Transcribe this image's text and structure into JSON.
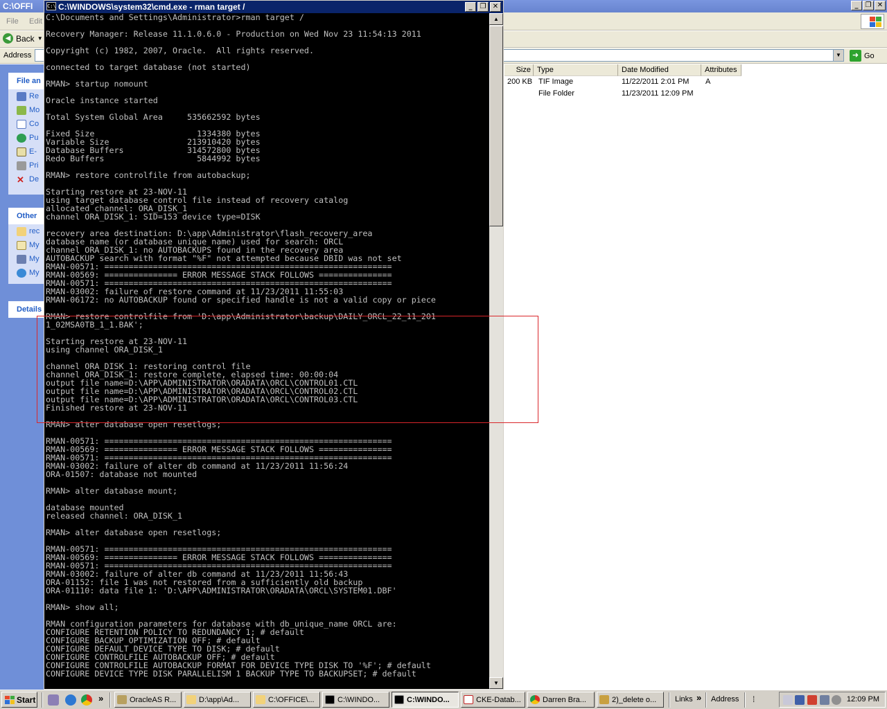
{
  "explorer": {
    "title": "C:\\OFFI",
    "menu": [
      "File",
      "Edit"
    ],
    "back_label": "Back",
    "address_label": "Address",
    "go_label": "Go",
    "tasks_file_head": "File an",
    "tasks_file_items": [
      "Re",
      "Mo",
      "Co",
      "Pu",
      "E-",
      "Pri",
      "De"
    ],
    "tasks_other_head": "Other",
    "tasks_other_items": [
      "rec",
      "My",
      "My",
      "My"
    ],
    "tasks_details_head": "Details",
    "columns": [
      "Size",
      "Type",
      "Date Modified",
      "Attributes"
    ],
    "rows": [
      {
        "size": "200 KB",
        "type": "TIF Image",
        "date": "11/22/2011 2:01 PM",
        "attr": "A"
      },
      {
        "size": "",
        "type": "File Folder",
        "date": "11/23/2011 12:09 PM",
        "attr": ""
      }
    ]
  },
  "cmd": {
    "title": "C:\\WINDOWS\\system32\\cmd.exe - rman target /",
    "icon_text": "C:\\",
    "console_text": "C:\\Documents and Settings\\Administrator>rman target /\n\nRecovery Manager: Release 11.1.0.6.0 - Production on Wed Nov 23 11:54:13 2011\n\nCopyright (c) 1982, 2007, Oracle.  All rights reserved.\n\nconnected to target database (not started)\n\nRMAN> startup nomount\n\nOracle instance started\n\nTotal System Global Area     535662592 bytes\n\nFixed Size                     1334380 bytes\nVariable Size                213910420 bytes\nDatabase Buffers             314572800 bytes\nRedo Buffers                   5844992 bytes\n\nRMAN> restore controlfile from autobackup;\n\nStarting restore at 23-NOV-11\nusing target database control file instead of recovery catalog\nallocated channel: ORA_DISK_1\nchannel ORA_DISK_1: SID=153 device type=DISK\n\nrecovery area destination: D:\\app\\Administrator\\flash_recovery_area\ndatabase name (or database unique name) used for search: ORCL\nchannel ORA_DISK_1: no AUTOBACKUPS found in the recovery area\nAUTOBACKUP search with format \"%F\" not attempted because DBID was not set\nRMAN-00571: ===========================================================\nRMAN-00569: =============== ERROR MESSAGE STACK FOLLOWS ===============\nRMAN-00571: ===========================================================\nRMAN-03002: failure of restore command at 11/23/2011 11:55:03\nRMAN-06172: no AUTOBACKUP found or specified handle is not a valid copy or piece\n\nRMAN> restore controlfile from 'D:\\app\\Administrator\\backup\\DAILY_ORCL_22_11_201\n1_02MSA0TB_1_1.BAK';\n\nStarting restore at 23-NOV-11\nusing channel ORA_DISK_1\n\nchannel ORA_DISK_1: restoring control file\nchannel ORA_DISK_1: restore complete, elapsed time: 00:00:04\noutput file name=D:\\APP\\ADMINISTRATOR\\ORADATA\\ORCL\\CONTROL01.CTL\noutput file name=D:\\APP\\ADMINISTRATOR\\ORADATA\\ORCL\\CONTROL02.CTL\noutput file name=D:\\APP\\ADMINISTRATOR\\ORADATA\\ORCL\\CONTROL03.CTL\nFinished restore at 23-NOV-11\n\nRMAN> alter database open resetlogs;\n\nRMAN-00571: ===========================================================\nRMAN-00569: =============== ERROR MESSAGE STACK FOLLOWS ===============\nRMAN-00571: ===========================================================\nRMAN-03002: failure of alter db command at 11/23/2011 11:56:24\nORA-01507: database not mounted\n\nRMAN> alter database mount;\n\ndatabase mounted\nreleased channel: ORA_DISK_1\n\nRMAN> alter database open resetlogs;\n\nRMAN-00571: ===========================================================\nRMAN-00569: =============== ERROR MESSAGE STACK FOLLOWS ===============\nRMAN-00571: ===========================================================\nRMAN-03002: failure of alter db command at 11/23/2011 11:56:43\nORA-01152: file 1 was not restored from a sufficiently old backup\nORA-01110: data file 1: 'D:\\APP\\ADMINISTRATOR\\ORADATA\\ORCL\\SYSTEM01.DBF'\n\nRMAN> show all;\n\nRMAN configuration parameters for database with db_unique_name ORCL are:\nCONFIGURE RETENTION POLICY TO REDUNDANCY 1; # default\nCONFIGURE BACKUP OPTIMIZATION OFF; # default\nCONFIGURE DEFAULT DEVICE TYPE TO DISK; # default\nCONFIGURE CONTROLFILE AUTOBACKUP OFF; # default\nCONFIGURE CONTROLFILE AUTOBACKUP FORMAT FOR DEVICE TYPE DISK TO '%F'; # default\nCONFIGURE DEVICE TYPE DISK PARALLELISM 1 BACKUP TYPE TO BACKUPSET; # default",
    "highlight_color": "#d9262a"
  },
  "taskbar": {
    "start_label": "Start",
    "more_glyph": "»",
    "buttons": [
      {
        "label": "OracleAS R...",
        "active": false
      },
      {
        "label": "D:\\app\\Ad...",
        "active": false
      },
      {
        "label": "C:\\OFFICE\\...",
        "active": false
      },
      {
        "label": "C:\\WINDO...",
        "active": false
      },
      {
        "label": "C:\\WINDO...",
        "active": true
      },
      {
        "label": "CKE-Datab...",
        "active": false
      },
      {
        "label": "Darren Bra...",
        "active": false
      },
      {
        "label": "2)_delete o...",
        "active": false
      }
    ],
    "links_label": "Links",
    "address_label": "Address",
    "clock": "12:09 PM"
  }
}
